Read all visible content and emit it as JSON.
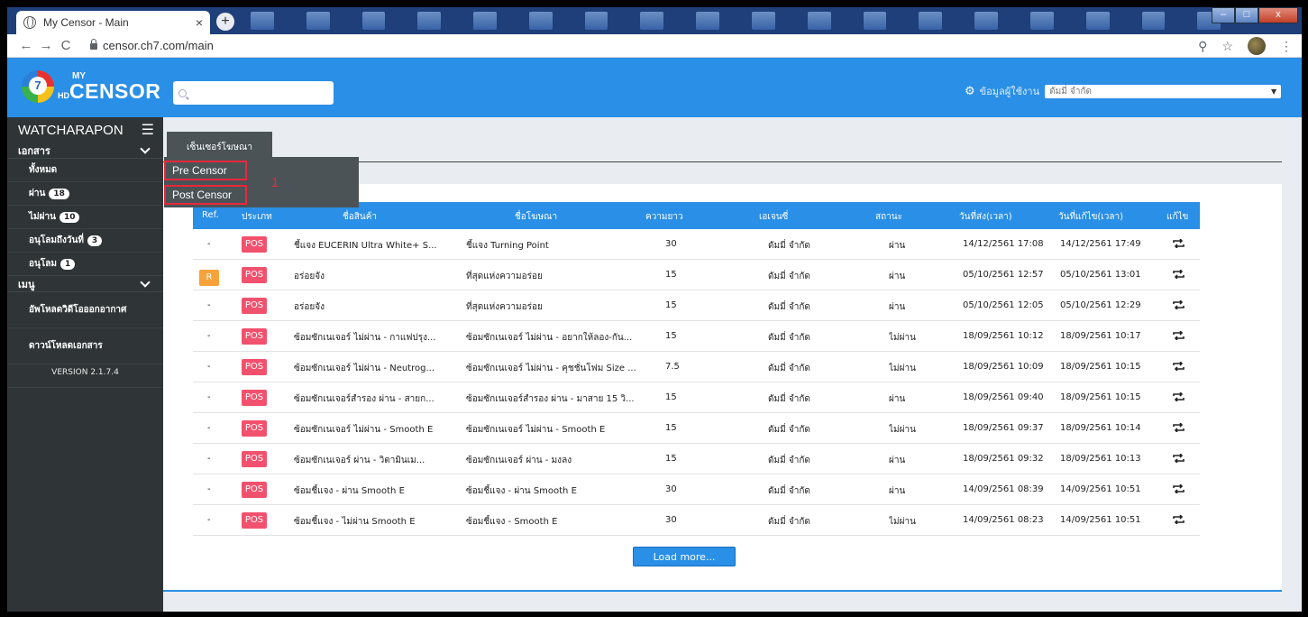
{
  "browser": {
    "tab_title": "My Censor - Main",
    "tab_close": "×",
    "new_tab": "+",
    "url": "censor.ch7.com/main",
    "back": "←",
    "forward": "→",
    "reload": "C",
    "zoom_icon": "⚲",
    "star_icon": "☆",
    "menu_icon": "⋮",
    "win_min": "–",
    "win_max": "□",
    "win_close": "x"
  },
  "header": {
    "logo_my": "MY",
    "logo_hd": "HD",
    "logo_censor": "CENSOR",
    "logo_seven": "7",
    "search_placeholder": "",
    "user_info_label": "ข้อมูลผู้ใช้งาน",
    "agency_selected": "ดัมมี่ จำกัด",
    "chevron": "▼",
    "accent_color": "#2a8fe6"
  },
  "sidebar": {
    "username": "WATCHARAPON",
    "hamburger": "☰",
    "section_documents": "เอกสาร",
    "items": [
      {
        "label": "ทั้งหมด",
        "badge": ""
      },
      {
        "label": "ผ่าน",
        "badge": "18"
      },
      {
        "label": "ไม่ผ่าน",
        "badge": "10"
      },
      {
        "label": "อนุโลมถึงวันที่",
        "badge": "3"
      },
      {
        "label": "อนุโลม",
        "badge": "1"
      }
    ],
    "section_menu": "เมนู",
    "upload": "อัพโหลดวิดีโอออกอากาศ",
    "download": "ดาวน์โหลดเอกสาร",
    "version": "VERSION 2.1.7.4"
  },
  "main": {
    "tab_label": "เซ็นเซอร์โฆษณา",
    "dropdown": {
      "pre": "Pre Censor",
      "post": "Post Censor",
      "marker": "1"
    },
    "columns": [
      "Ref.",
      "ประเภท",
      "ชื่อสินค้า",
      "ชื่อโฆษณา",
      "ความยาว",
      "เอเจนซี่",
      "สถานะ",
      "วันที่ส่ง(เวลา)",
      "วันที่แก้ไข(เวลา)",
      "แก้ไข"
    ],
    "rows": [
      {
        "ref": "-",
        "type": "POS",
        "product": "ชี้แจง EUCERIN Ultra White+ S...",
        "ad": "ชี้แจง Turning Point",
        "length": "30",
        "agency": "ดัมมี่ จำกัด",
        "status": "ผ่าน",
        "sent": "14/12/2561 17:08",
        "edited": "14/12/2561 17:49"
      },
      {
        "ref": "R",
        "type": "POS",
        "product": "อร่อยจัง",
        "ad": "ที่สุดแห่งความอร่อย",
        "length": "15",
        "agency": "ดัมมี่ จำกัด",
        "status": "ผ่าน",
        "sent": "05/10/2561 12:57",
        "edited": "05/10/2561 13:01"
      },
      {
        "ref": "-",
        "type": "POS",
        "product": "อร่อยจัง",
        "ad": "ที่สุดแห่งความอร่อย",
        "length": "15",
        "agency": "ดัมมี่ จำกัด",
        "status": "ผ่าน",
        "sent": "05/10/2561 12:05",
        "edited": "05/10/2561 12:29"
      },
      {
        "ref": "-",
        "type": "POS",
        "product": "ซ้อมซักเนเจอร์ ไม่ผ่าน - กาแฟปรุง...",
        "ad": "ซ้อมซักเนเจอร์ ไม่ผ่าน - อยากให้ลอง-กัน...",
        "length": "15",
        "agency": "ดัมมี่ จำกัด",
        "status": "ไม่ผ่าน",
        "sent": "18/09/2561 10:12",
        "edited": "18/09/2561 10:17"
      },
      {
        "ref": "-",
        "type": "POS",
        "product": "ซ้อมซักเนเจอร์ ไม่ผ่าน - Neutrog...",
        "ad": "ซ้อมซักเนเจอร์ ไม่ผ่าน - คุชชั่นโฟม Size ...",
        "length": "7.5",
        "agency": "ดัมมี่ จำกัด",
        "status": "ไม่ผ่าน",
        "sent": "18/09/2561 10:09",
        "edited": "18/09/2561 10:15"
      },
      {
        "ref": "-",
        "type": "POS",
        "product": "ซ้อมซักเนเจอร์สำรอง ผ่าน - สายก...",
        "ad": "ซ้อมซักเนเจอร์สำรอง ผ่าน - มาสาย 15 วิ...",
        "length": "15",
        "agency": "ดัมมี่ จำกัด",
        "status": "ผ่าน",
        "sent": "18/09/2561 09:40",
        "edited": "18/09/2561 10:15"
      },
      {
        "ref": "-",
        "type": "POS",
        "product": "ซ้อมซักเนเจอร์ ไม่ผ่าน - Smooth E",
        "ad": "ซ้อมซักเนเจอร์ ไม่ผ่าน - Smooth E",
        "length": "15",
        "agency": "ดัมมี่ จำกัด",
        "status": "ไม่ผ่าน",
        "sent": "18/09/2561 09:37",
        "edited": "18/09/2561 10:14"
      },
      {
        "ref": "-",
        "type": "POS",
        "product": "ซ้อมซักเนเจอร์ ผ่าน - วิตามินเม...",
        "ad": "ซ้อมซักเนเจอร์ ผ่าน - มงลง",
        "length": "15",
        "agency": "ดัมมี่ จำกัด",
        "status": "ผ่าน",
        "sent": "18/09/2561 09:32",
        "edited": "18/09/2561 10:13"
      },
      {
        "ref": "-",
        "type": "POS",
        "product": "ซ้อมชี้แจง - ผ่าน Smooth E",
        "ad": "ซ้อมชี้แจง - ผ่าน Smooth E",
        "length": "30",
        "agency": "ดัมมี่ จำกัด",
        "status": "ผ่าน",
        "sent": "14/09/2561 08:39",
        "edited": "14/09/2561 10:51"
      },
      {
        "ref": "-",
        "type": "POS",
        "product": "ซ้อมชี้แจง - ไม่ผ่าน Smooth E",
        "ad": "ซ้อมชี้แจง - Smooth E",
        "length": "30",
        "agency": "ดัมมี่ จำกัด",
        "status": "ไม่ผ่าน",
        "sent": "14/09/2561 08:23",
        "edited": "14/09/2561 10:51"
      }
    ],
    "load_more": "Load more..."
  }
}
